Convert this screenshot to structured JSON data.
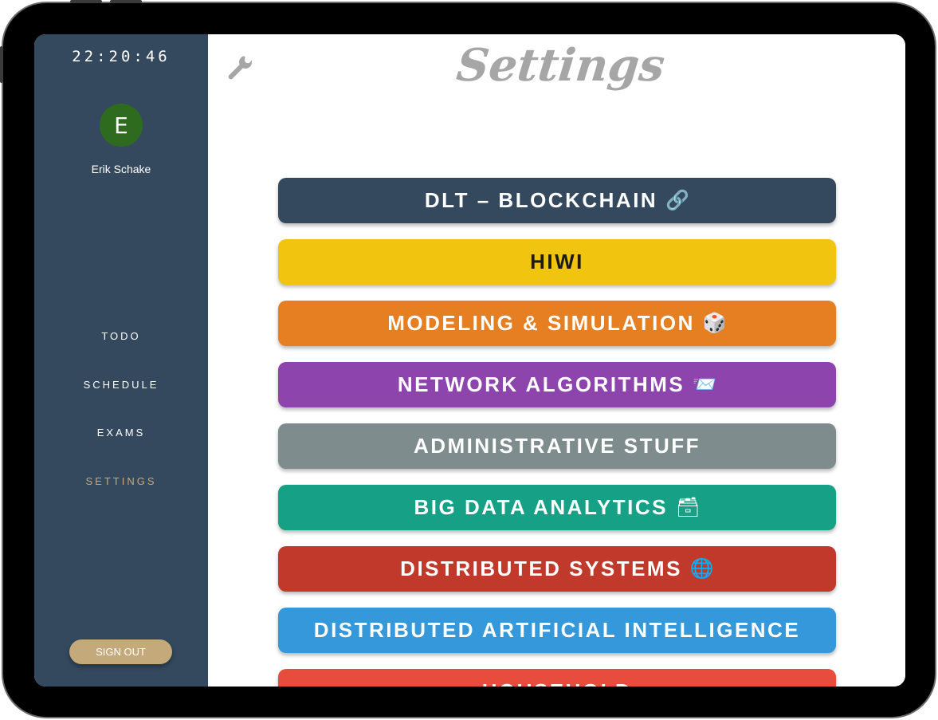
{
  "clock": "22:20:46",
  "user": {
    "initial": "E",
    "name": "Erik Schake"
  },
  "nav": [
    {
      "label": "TODO"
    },
    {
      "label": "SCHEDULE"
    },
    {
      "label": "EXAMS"
    },
    {
      "label": "SETTINGS",
      "active": true
    }
  ],
  "signout_label": "SIGN OUT",
  "page_title": "Settings",
  "courses": [
    {
      "label": "DLT – BLOCKCHAIN",
      "emoji": "🔗",
      "color": "#34495e",
      "text_color": "#ffffff"
    },
    {
      "label": "HIWI",
      "emoji": "",
      "color": "#f1c40f",
      "text_color": "#1a1a1a"
    },
    {
      "label": "MODELING & SIMULATION",
      "emoji": "🎲",
      "color": "#e67e22",
      "text_color": "#ffffff"
    },
    {
      "label": "NETWORK ALGORITHMS",
      "emoji": "📨",
      "color": "#8e44ad",
      "text_color": "#ffffff"
    },
    {
      "label": "ADMINISTRATIVE STUFF",
      "emoji": "",
      "color": "#7f8c8d",
      "text_color": "#ffffff"
    },
    {
      "label": "BIG DATA ANALYTICS",
      "emoji": "🗃",
      "color": "#16a085",
      "text_color": "#ffffff"
    },
    {
      "label": "DISTRIBUTED SYSTEMS",
      "emoji": "🌐",
      "color": "#c0392b",
      "text_color": "#ffffff"
    },
    {
      "label": "DISTRIBUTED ARTIFICIAL INTELLIGENCE",
      "emoji": "",
      "color": "#3498db",
      "text_color": "#ffffff"
    },
    {
      "label": "HOUSEHOLD",
      "emoji": "",
      "color": "#e74c3c",
      "text_color": "#ffffff"
    }
  ],
  "colors": {
    "sidebar": "#34495e",
    "accent": "#c4a97a",
    "avatar": "#2e6b1f",
    "title": "#a6a6a6"
  },
  "icons": {
    "settings": "wrench-icon"
  }
}
